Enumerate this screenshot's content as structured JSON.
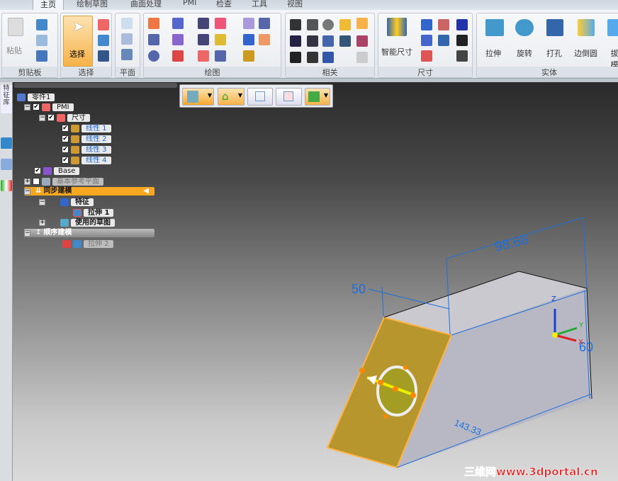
{
  "tabs": [
    "主页",
    "绘制草图",
    "曲面处理",
    "PMI",
    "检查",
    "工具",
    "视图"
  ],
  "active_tab": "主页",
  "ribbon": {
    "groups": [
      "剪贴板",
      "选择",
      "平面",
      "绘图",
      "相关",
      "尺寸",
      "实体"
    ],
    "paste": "粘贴",
    "select": "选择",
    "smart_dimension": "智能尺寸",
    "solids": [
      "拉伸",
      "旋转",
      "打孔",
      "边倒圆",
      "拔模"
    ]
  },
  "leftstrip": {
    "vertical_label": "特征库"
  },
  "tree": {
    "root": "零件1",
    "pmi": "PMI",
    "dims": "尺寸",
    "linear": [
      "线性 1",
      "线性 2",
      "线性 3",
      "线性 4"
    ],
    "base": "Base",
    "ref_planes": "基本参考平面",
    "sync": "同步建模",
    "features": "特征",
    "extrude1": "拉伸 1",
    "used_sketches": "使用的草图",
    "ordered": "顺序建模",
    "extrude2": "拉伸 2"
  },
  "dimensions": {
    "d1": "98.68",
    "d2": "50",
    "d3": "60",
    "d4": "143.33"
  },
  "axes": {
    "x": "X",
    "y": "Y",
    "z": "Z"
  },
  "watermark": "三维网www.3dportal.cn",
  "colors": {
    "accent": "#f7b24a",
    "dimension": "#1e6fdc",
    "face_selected": "#b8962e"
  }
}
